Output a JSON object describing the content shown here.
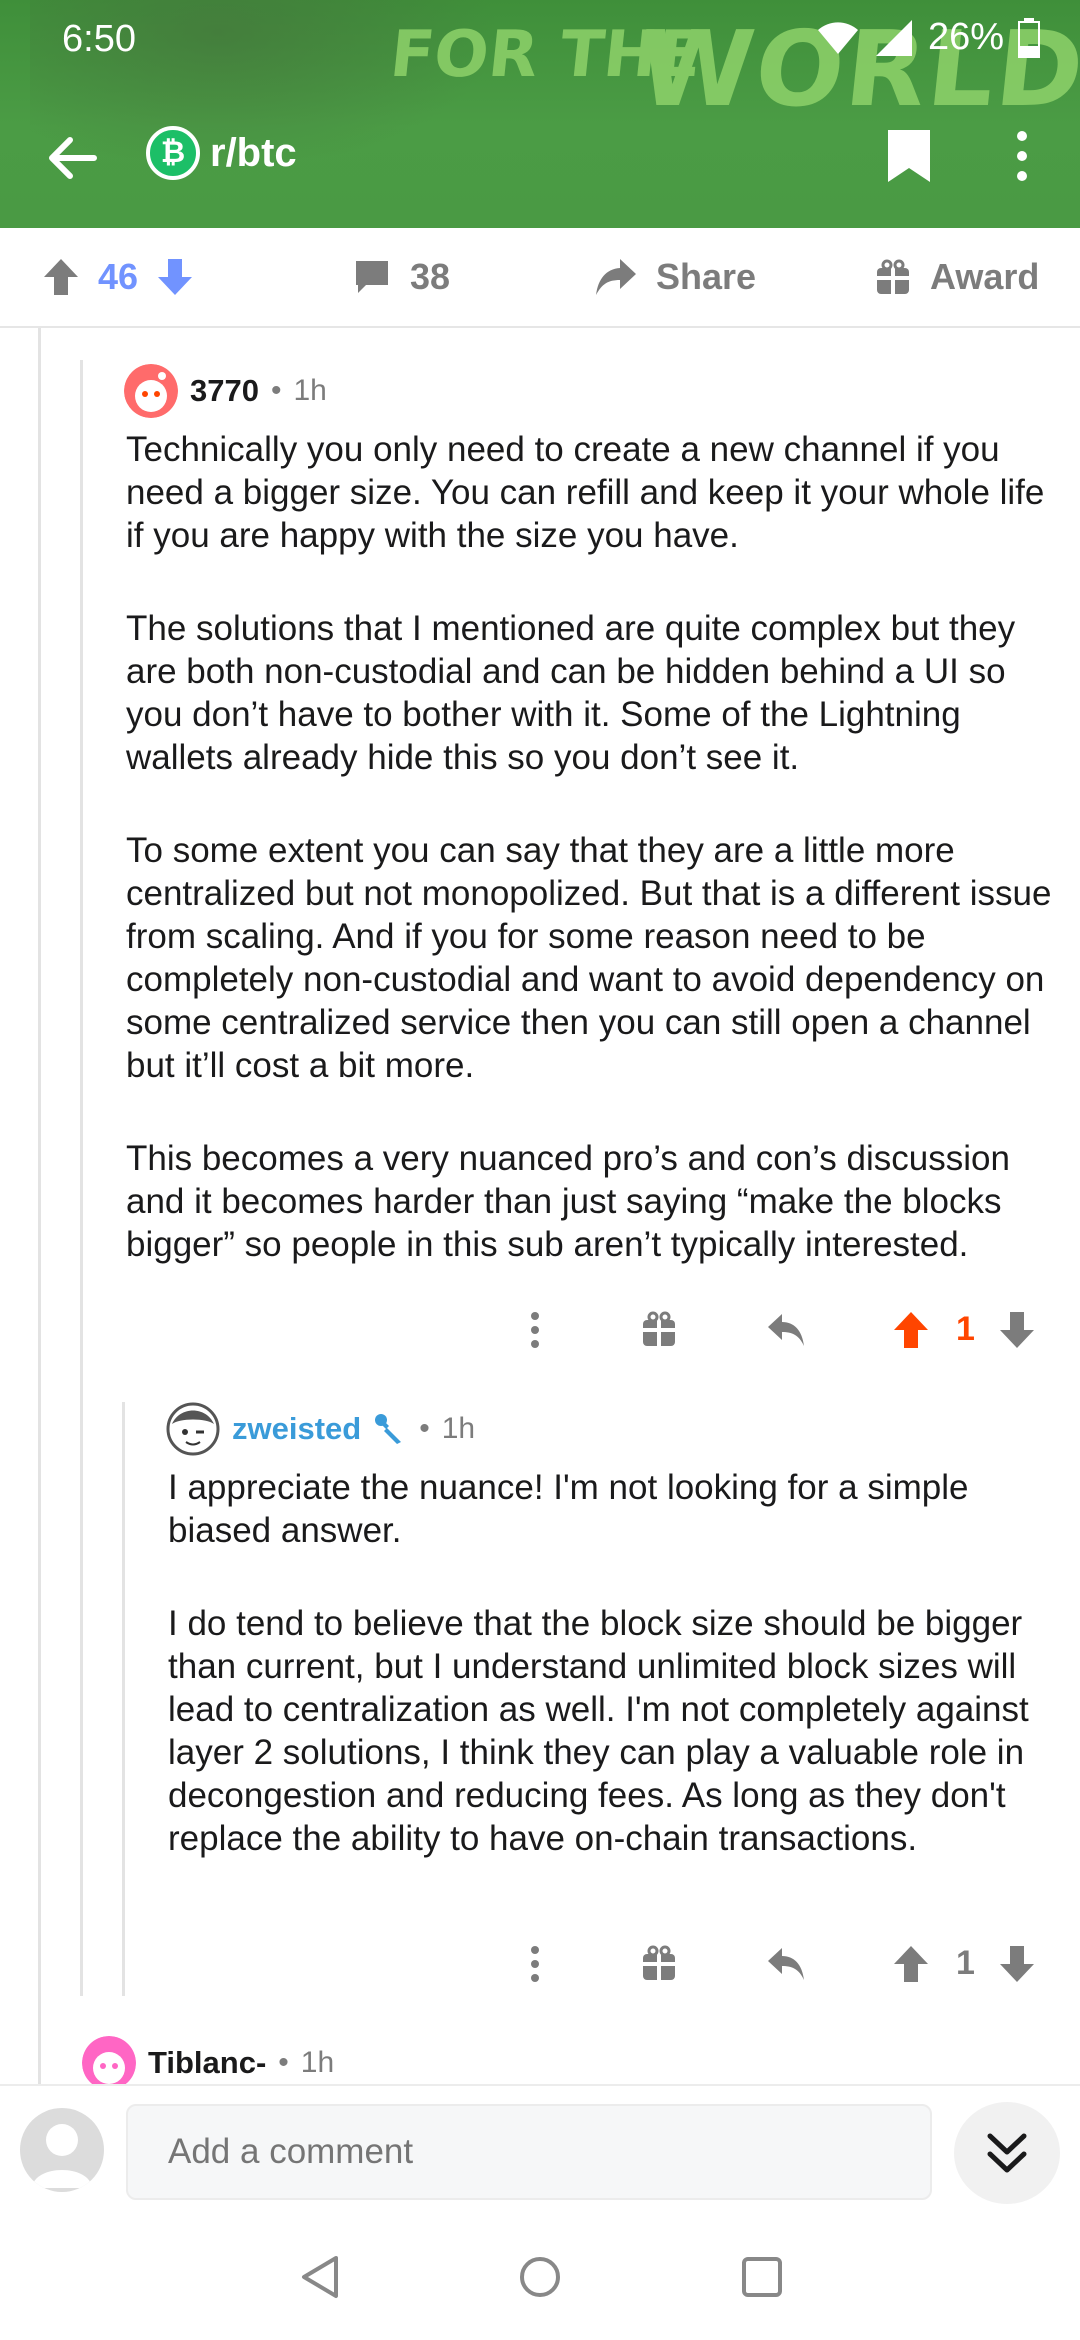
{
  "status_bar": {
    "time": "6:50",
    "battery": "26%"
  },
  "banner": {
    "line1": "FOR THE",
    "line2": "WORLD?"
  },
  "appbar": {
    "subreddit": "r/btc",
    "sub_icon_letter": "₿"
  },
  "post_actions": {
    "score": "46",
    "comments": "38",
    "share": "Share",
    "award": "Award"
  },
  "comments": [
    {
      "author": "3770",
      "time": "1h",
      "paragraphs": [
        "Technically you only need to create a new channel if you need a bigger size. You can refill and keep it your whole life if you are happy with the size you have.",
        "The solutions that I mentioned are quite complex but they are both non-custodial and can be hidden behind a UI so you don’t have to bother with it. Some of the Lightning wallets already hide this so you don’t see it.",
        "To some extent you can say that they are a little more centralized but not monopolized. But that is a different issue from scaling. And if you for some reason need to be completely non-custodial and want to avoid dependency on some centralized service then you can still open a channel but it’ll cost a bit more.",
        "This becomes a very nuanced pro’s and con’s discussion and it becomes harder than just saying “make the blocks bigger” so people in this sub aren’t typically interested."
      ],
      "score": "1"
    },
    {
      "author": "zweisted",
      "time": "1h",
      "paragraphs": [
        "I appreciate the nuance! I'm not looking for a simple biased answer.",
        "I do tend to believe that the block size should be bigger than current, but I understand unlimited block sizes will lead to centralization as well. I'm not completely against layer 2 solutions, I think they can play a valuable role in decongestion and reducing fees. As long as they don't replace the ability to have on-chain transactions."
      ],
      "score": "1"
    },
    {
      "author": "Tiblanc-",
      "time": "1h"
    }
  ],
  "composer": {
    "placeholder": "Add a comment"
  },
  "colors": {
    "header_green": "#4a9a44",
    "upvoted": "#ff4500",
    "score_blue": "#7193ff",
    "flair_blue": "#3a9bd9"
  }
}
